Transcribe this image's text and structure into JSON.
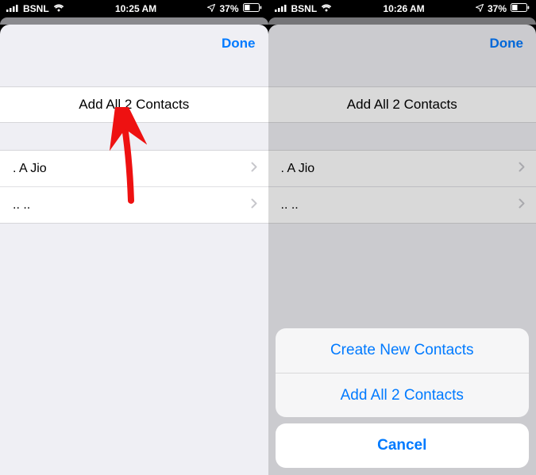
{
  "left": {
    "status": {
      "carrier": "BSNL",
      "time": "10:25 AM",
      "battery": "37%"
    },
    "nav": {
      "done": "Done"
    },
    "addAll": "Add All 2 Contacts",
    "contacts": [
      ". A Jio",
      ".. .."
    ]
  },
  "right": {
    "status": {
      "carrier": "BSNL",
      "time": "10:26 AM",
      "battery": "37%"
    },
    "nav": {
      "done": "Done"
    },
    "addAll": "Add All 2 Contacts",
    "contacts": [
      ". A Jio",
      ".. .."
    ],
    "sheet": {
      "createNew": "Create New Contacts",
      "addAll": "Add All 2 Contacts",
      "cancel": "Cancel"
    }
  }
}
